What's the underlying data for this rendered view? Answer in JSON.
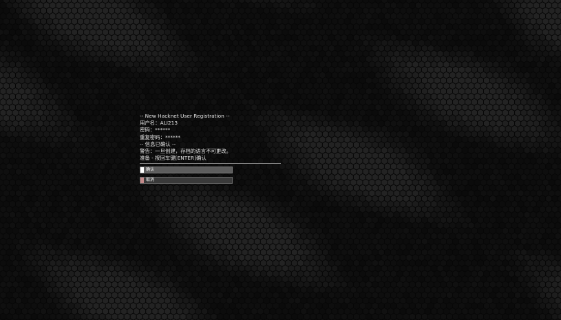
{
  "registration": {
    "header": "-- New Hacknet User Registration --",
    "username_line": "用户名：ALI213",
    "password_line": "密码：******",
    "repeat_password_line": "重复密码：******",
    "confirmed_line": "-- 信息已确认 --",
    "warning_line": "警告：一旦创建，存档的语言不可更改。",
    "ready_line": "准备 - 按回车键[ENTER]确认"
  },
  "buttons": {
    "confirm_label": "确认",
    "cancel_label": "取消"
  },
  "colors": {
    "background": "#070707",
    "hex_fill": "#262626",
    "confirm_accent": "#ffffff",
    "cancel_accent": "#c48a8a",
    "text": "#e6e6e6"
  }
}
